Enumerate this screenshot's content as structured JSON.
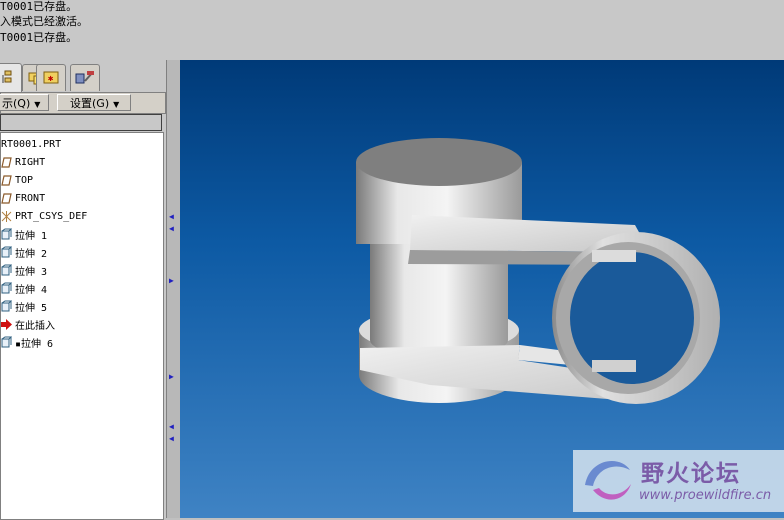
{
  "messages": [
    "T0001已存盘。",
    "入模式已经激活。",
    "T0001已存盘。"
  ],
  "tabs": [
    {
      "icon": "model-tree-icon"
    },
    {
      "icon": "folder-browser-icon"
    },
    {
      "icon": "favorites-icon"
    },
    {
      "icon": "connections-icon"
    }
  ],
  "menus": {
    "show_label": "示(Q)",
    "settings_label": "设置(G)"
  },
  "tree": [
    {
      "label": "RT0001.PRT",
      "icon": "part-icon"
    },
    {
      "label": "RIGHT",
      "icon": "datum-plane-icon"
    },
    {
      "label": "TOP",
      "icon": "datum-plane-icon"
    },
    {
      "label": "FRONT",
      "icon": "datum-plane-icon"
    },
    {
      "label": "PRT_CSYS_DEF",
      "icon": "coordinate-system-icon"
    },
    {
      "label": "拉伸 1",
      "icon": "extrude-icon"
    },
    {
      "label": "拉伸 2",
      "icon": "extrude-icon"
    },
    {
      "label": "拉伸 3",
      "icon": "extrude-icon"
    },
    {
      "label": "拉伸 4",
      "icon": "extrude-icon"
    },
    {
      "label": "拉伸 5",
      "icon": "extrude-icon"
    },
    {
      "label": "在此插入",
      "icon": "insert-here-arrow-icon"
    },
    {
      "label": "▪拉伸 6",
      "icon": "extrude-icon"
    }
  ],
  "watermark": {
    "title": "野火论坛",
    "url": "www.proewildfire.cn"
  },
  "colors": {
    "viewport_top": "#003a78",
    "viewport_bottom": "#3f83c4",
    "model_gray": "#b8b8b8"
  }
}
